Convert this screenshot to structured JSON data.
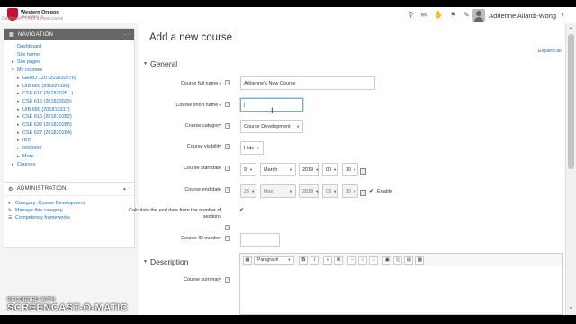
{
  "navbar": {
    "logo_name": "Western Oregon",
    "logo_sub": "UNIVERSITY",
    "breadcrumb": "Dashboard  /  Add a new course",
    "user_name": "Adrienne Allardt-Wong",
    "icons": [
      "search-icon",
      "message-icon",
      "hand-icon",
      "notification-icon",
      "chat-icon"
    ]
  },
  "sidebar": {
    "nav_title": "NAVIGATION",
    "nav_items": [
      {
        "label": "Dashboard",
        "level": 0,
        "expand": false
      },
      {
        "label": "Site home",
        "level": 0,
        "expand": false,
        "icon": "home-icon"
      },
      {
        "label": "Site pages",
        "level": 0,
        "expand": true
      },
      {
        "label": "My courses",
        "level": 0,
        "expand": true,
        "open": true
      },
      {
        "label": "GERO 120 (201820276)",
        "level": 1,
        "expand": true
      },
      {
        "label": "UIB 686 (201820195)",
        "level": 1,
        "expand": true
      },
      {
        "label": "CSE 617 (20182026...)",
        "level": 1,
        "expand": true
      },
      {
        "label": "CSE 615 (201820025)",
        "level": 1,
        "expand": true
      },
      {
        "label": "UIB 680 (201810317)",
        "level": 1,
        "expand": true
      },
      {
        "label": "CSE 616 (201810282)",
        "level": 1,
        "expand": true
      },
      {
        "label": "CSE 632 (201820285)",
        "level": 1,
        "expand": true
      },
      {
        "label": "CSE 627 (201820284)",
        "level": 1,
        "expand": true
      },
      {
        "label": "IDC",
        "level": 1,
        "expand": true
      },
      {
        "label": "0000000",
        "level": 1,
        "expand": true
      },
      {
        "label": "More...",
        "level": 1,
        "expand": true
      },
      {
        "label": "Courses",
        "level": 0,
        "expand": true
      }
    ],
    "admin_title": "ADMINISTRATION",
    "admin_items": [
      {
        "label": "Category: Course Development",
        "icon": "chevron-down-icon"
      },
      {
        "label": "Manage this category",
        "icon": "pencil-icon"
      },
      {
        "label": "Competency frameworks",
        "icon": "list-icon"
      }
    ]
  },
  "main": {
    "title": "Add a new course",
    "expand_all": "Expand all",
    "section_general": "General",
    "section_description": "Description",
    "fields": {
      "fullname_label": "Course full name",
      "fullname_value": "Adrienne's New Course",
      "shortname_label": "Course short name",
      "shortname_value": "|",
      "category_label": "Course category",
      "category_value": "Course Development",
      "visibility_label": "Course visibility",
      "visibility_value": "Hide",
      "start_label": "Course start date",
      "start_day": "9",
      "start_month": "March",
      "start_year": "2019",
      "start_hour": "00",
      "start_min": "00",
      "end_label": "Course end date",
      "end_day": "25",
      "end_month": "May",
      "end_year": "2019",
      "end_hour": "03",
      "end_min": "00",
      "end_enable": "Enable",
      "calc_label": "Calculate the end date from the number of sections",
      "idnumber_label": "Course ID number",
      "idnumber_value": "",
      "summary_label": "Course summary"
    },
    "editor": {
      "paragraph": "Paragraph",
      "bold": "B",
      "italic": "I"
    }
  },
  "watermark": {
    "line1": "RECORDED WITH",
    "line2": "SCREENCAST-O-MATIC"
  },
  "colors": {
    "link": "#1a6eb5",
    "required": "#c8102e",
    "nav_header": "#666666",
    "brand": "#c8102e"
  }
}
